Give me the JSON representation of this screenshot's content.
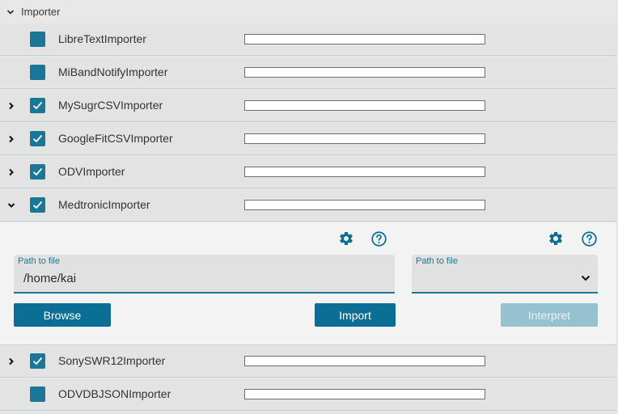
{
  "section": {
    "title": "Importer"
  },
  "importers": [
    {
      "name": "LibreTextImporter",
      "checked": false,
      "expander": "none",
      "progress": 0
    },
    {
      "name": "MiBandNotifyImporter",
      "checked": false,
      "expander": "none",
      "progress": 0
    },
    {
      "name": "MySugrCSVImporter",
      "checked": true,
      "expander": "collapsed",
      "progress": 0
    },
    {
      "name": "GoogleFitCSVImporter",
      "checked": true,
      "expander": "collapsed",
      "progress": 0
    },
    {
      "name": "ODVImporter",
      "checked": true,
      "expander": "collapsed",
      "progress": 0
    },
    {
      "name": "MedtronicImporter",
      "checked": true,
      "expander": "expanded",
      "progress": 0
    },
    {
      "name": "SonySWR12Importer",
      "checked": true,
      "expander": "collapsed",
      "progress": 0
    },
    {
      "name": "ODVDBJSONImporter",
      "checked": false,
      "expander": "none",
      "progress": 0
    }
  ],
  "panel": {
    "left": {
      "path_label": "Path to file",
      "path_value": "/home/kai",
      "browse_label": "Browse",
      "import_label": "Import"
    },
    "right": {
      "path_label": "Path to file",
      "path_value": "",
      "interpret_label": "Interpret",
      "interpret_enabled": false
    },
    "icons": [
      "gear-icon",
      "help-circle-icon"
    ]
  },
  "colors": {
    "accent": "#1b7797",
    "button": "#0b6e95",
    "button_disabled": "#96c1d1",
    "row_bg": "#e3e3e3",
    "panel_bg": "#f3f3f3"
  }
}
